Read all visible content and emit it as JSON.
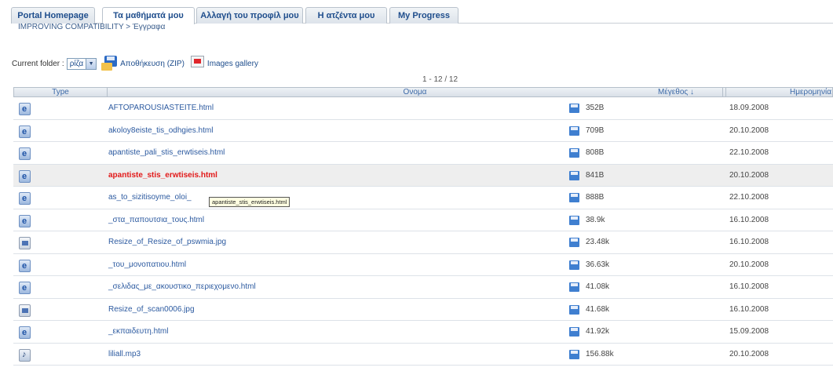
{
  "tabs": [
    {
      "label": "Portal Homepage",
      "active": false
    },
    {
      "label": "Τα μαθήματά μου",
      "active": true
    },
    {
      "label": "Αλλαγή του προφίλ μου",
      "active": false
    },
    {
      "label": "Η ατζέντα μου",
      "active": false
    },
    {
      "label": "My Progress",
      "active": false
    }
  ],
  "breadcrumb": "IMPROVING COMPATIBILITY > Έγγραφα",
  "toolbar": {
    "folder_label": "Current folder :",
    "folder_value": "ρίζα",
    "zip_label": "Αποθήκευση (ZIP)",
    "gallery_label": "Images gallery"
  },
  "pager": "1 - 12 / 12",
  "columns": {
    "type": "Type",
    "name": "Ονομα",
    "size": "Μέγεθος ↓",
    "date": "Ημερομηνία"
  },
  "files": [
    {
      "type": "html",
      "name": "AFTOPAROUSIASTEITE.html",
      "size": "352B",
      "date": "18.09.2008"
    },
    {
      "type": "html",
      "name": "akoloy8eiste_tis_odhgies.html",
      "size": "709B",
      "date": "20.10.2008"
    },
    {
      "type": "html",
      "name": "apantiste_pali_stis_erwtiseis.html",
      "size": "808B",
      "date": "22.10.2008"
    },
    {
      "type": "html",
      "name": "apantiste_stis_erwtiseis.html",
      "size": "841B",
      "date": "20.10.2008"
    },
    {
      "type": "html",
      "name": "as_to_sizitisoyme_oloi_",
      "size": "888B",
      "date": "22.10.2008"
    },
    {
      "type": "html",
      "name": "_στα_παπουτσια_τους.html",
      "size": "38.9k",
      "date": "16.10.2008"
    },
    {
      "type": "jpg",
      "name": "Resize_of_Resize_of_pswmia.jpg",
      "size": "23.48k",
      "date": "16.10.2008"
    },
    {
      "type": "html",
      "name": "_του_μονοπατιου.html",
      "size": "36.63k",
      "date": "20.10.2008"
    },
    {
      "type": "html",
      "name": "_σελιδας_με_ακουστικο_περιεχομενο.html",
      "size": "41.08k",
      "date": "16.10.2008"
    },
    {
      "type": "jpg",
      "name": "Resize_of_scan0006.jpg",
      "size": "41.68k",
      "date": "16.10.2008"
    },
    {
      "type": "html",
      "name": "_εκπαιδευτη.html",
      "size": "41.92k",
      "date": "15.09.2008"
    },
    {
      "type": "mp3",
      "name": "liliall.mp3",
      "size": "156.88k",
      "date": "20.10.2008"
    }
  ],
  "hover_row": 3,
  "tooltip": "apantiste_stis_erwtiseis.html",
  "colors": {
    "link": "#2c5aa0",
    "active_link": "#e21a1a",
    "tab_text": "#1e4d8c"
  }
}
